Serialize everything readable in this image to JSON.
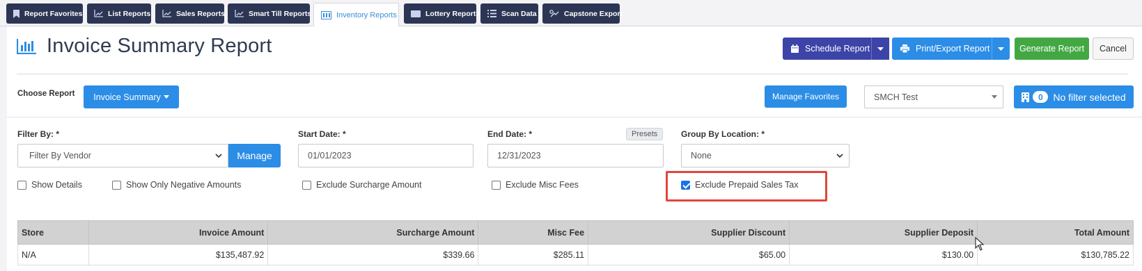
{
  "tabs": [
    {
      "label": "Report Favorites",
      "icon": "bookmark-icon"
    },
    {
      "label": "List Reports",
      "icon": "line-chart-icon"
    },
    {
      "label": "Sales Reports",
      "icon": "line-chart-icon"
    },
    {
      "label": "Smart Till Reports",
      "icon": "line-chart-icon"
    },
    {
      "label": "Inventory Reports",
      "icon": "inventory-icon",
      "active": true
    },
    {
      "label": "Lottery Reports",
      "icon": "ticket-icon"
    },
    {
      "label": "Scan Data",
      "icon": "list-icon"
    },
    {
      "label": "Capstone Export",
      "icon": "export-icon"
    }
  ],
  "page": {
    "title": "Invoice Summary Report",
    "title_icon": "bar-chart-icon"
  },
  "actions": {
    "schedule_label": "Schedule Report",
    "print_label": "Print/Export Report",
    "generate_label": "Generate Report",
    "cancel_label": "Cancel"
  },
  "report_selector": {
    "label": "Choose Report",
    "value": "Invoice Summary",
    "manage_favorites_label": "Manage Favorites",
    "store_value": "SMCH Test",
    "filter_count": "0",
    "filter_label": "No filter selected"
  },
  "filters": {
    "filter_by_label": "Filter By: *",
    "filter_by_value": "Filter By Vendor",
    "manage_label": "Manage",
    "start_date_label": "Start Date: *",
    "start_date_value": "01/01/2023",
    "end_date_label": "End Date: *",
    "end_date_value": "12/31/2023",
    "presets_label": "Presets",
    "group_by_label": "Group By Location: *",
    "group_by_value": "None"
  },
  "options": [
    {
      "label": "Show Details",
      "checked": false
    },
    {
      "label": "Show Only Negative Amounts",
      "checked": false
    },
    {
      "label": "Exclude Surcharge Amount",
      "checked": false
    },
    {
      "label": "Exclude Misc Fees",
      "checked": false
    },
    {
      "label": "Exclude Prepaid Sales Tax",
      "checked": true
    }
  ],
  "table": {
    "columns": [
      "Store",
      "Invoice Amount",
      "Surcharge Amount",
      "Misc Fee",
      "Supplier Discount",
      "Supplier Deposit",
      "Total Amount"
    ],
    "rows": [
      [
        "N/A",
        "$135,487.92",
        "$339.66",
        "$285.11",
        "$65.00",
        "$130.00",
        "$130,785.22"
      ]
    ]
  },
  "colors": {
    "tab_bg": "#2c3654",
    "accent_blue": "#2b8de6",
    "schedule_navy": "#3d44a8",
    "generate_green": "#43a843",
    "highlight_red": "#e0463a"
  }
}
